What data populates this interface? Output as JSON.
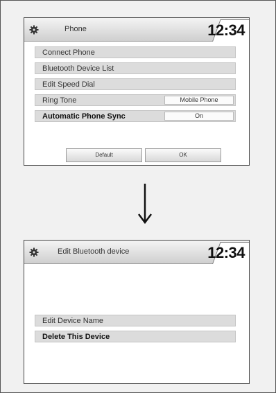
{
  "screen1": {
    "title": "Phone",
    "clock": "12:34",
    "menu": [
      {
        "label": "Connect Phone",
        "value": null,
        "bold": false
      },
      {
        "label": "Bluetooth Device List",
        "value": null,
        "bold": false
      },
      {
        "label": "Edit Speed Dial",
        "value": null,
        "bold": false
      },
      {
        "label": "Ring Tone",
        "value": "Mobile Phone",
        "bold": false
      },
      {
        "label": "Automatic Phone Sync",
        "value": "On",
        "bold": true
      }
    ],
    "buttons": {
      "default": "Default",
      "ok": "OK"
    },
    "icons": {
      "settings": "gear-icon"
    }
  },
  "arrow": {
    "icon": "down-arrow-icon"
  },
  "screen2": {
    "title": "Edit Bluetooth device",
    "clock": "12:34",
    "menu": [
      {
        "label": "Edit Device Name",
        "bold": false
      },
      {
        "label": "Delete This Device",
        "bold": true
      }
    ],
    "icons": {
      "settings": "gear-icon"
    }
  },
  "colors": {
    "row_bg": "#dcdcdc",
    "screen_bg": "#ffffff",
    "border": "#444444"
  }
}
